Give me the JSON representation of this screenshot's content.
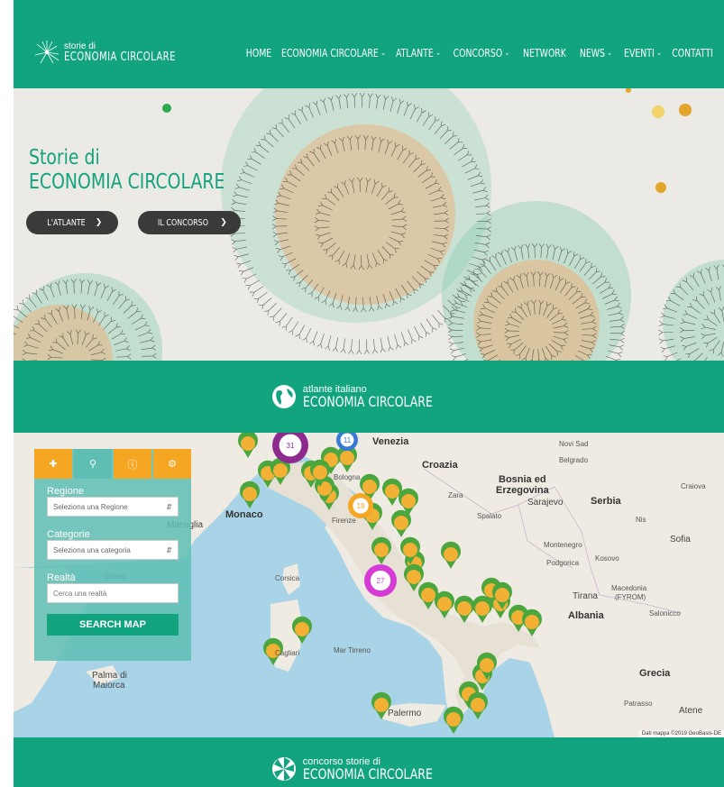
{
  "header": {
    "logo_line1": "storie di",
    "logo_line2": "ECONOMIA CIRCOLARE",
    "nav": [
      {
        "label": "HOME",
        "dropdown": false
      },
      {
        "label": "ECONOMIA CIRCOLARE",
        "dropdown": true
      },
      {
        "label": "ATLANTE",
        "dropdown": true
      },
      {
        "label": "CONCORSO",
        "dropdown": true
      },
      {
        "label": "NETWORK",
        "dropdown": false
      },
      {
        "label": "NEWS",
        "dropdown": true
      },
      {
        "label": "EVENTI",
        "dropdown": true
      },
      {
        "label": "CONTATTI",
        "dropdown": false
      }
    ]
  },
  "hero": {
    "title_line1": "Storie di",
    "title_line2": "ECONOMIA CIRCOLARE",
    "btn_atlante": "L'ATLANTE",
    "btn_concorso": "IL CONCORSO"
  },
  "atlante_band": {
    "line1": "atlante italiano",
    "line2": "ECONOMIA CIRCOLARE"
  },
  "map_panel": {
    "regione_label": "Regione",
    "regione_placeholder": "Seleziona una Regione",
    "categorie_label": "Categorie",
    "categorie_placeholder": "Seleziona una categoria",
    "realta_label": "Realtà",
    "realta_placeholder": "Cerca una realtà",
    "search_button": "SEARCH MAP"
  },
  "map": {
    "labels": [
      "Venezia",
      "Croazia",
      "Bosnia ed",
      "Erzegovina",
      "Sarajevo",
      "Serbia",
      "Monaco",
      "Marsiglia",
      "Firenze",
      "Bologna",
      "Montenegro",
      "Kosovo",
      "Corsica",
      "Girona",
      "Tirana",
      "Macedonia",
      "(FYROM)",
      "Albania",
      "Salonicco",
      "Palma di",
      "Maiorca",
      "Grecia",
      "Cagliari",
      "Palermo",
      "Atene",
      "Zara",
      "Spalato",
      "Sofia",
      "Novi Sad",
      "Belgrado",
      "Nis",
      "Craiova",
      "Mar Tirreno",
      "Podgorica",
      "Patrasso"
    ],
    "cluster_counts": [
      "31",
      "11",
      "19",
      "27"
    ],
    "attribution": "Dati mappa ©2019 GeoBasis-DE"
  },
  "concorso_band": {
    "line1": "concorso storie di",
    "line2": "ECONOMIA CIRCOLARE"
  },
  "colors": {
    "brand": "#12a37f",
    "accent": "#f5a623",
    "cluster": "#8e2a8e"
  }
}
